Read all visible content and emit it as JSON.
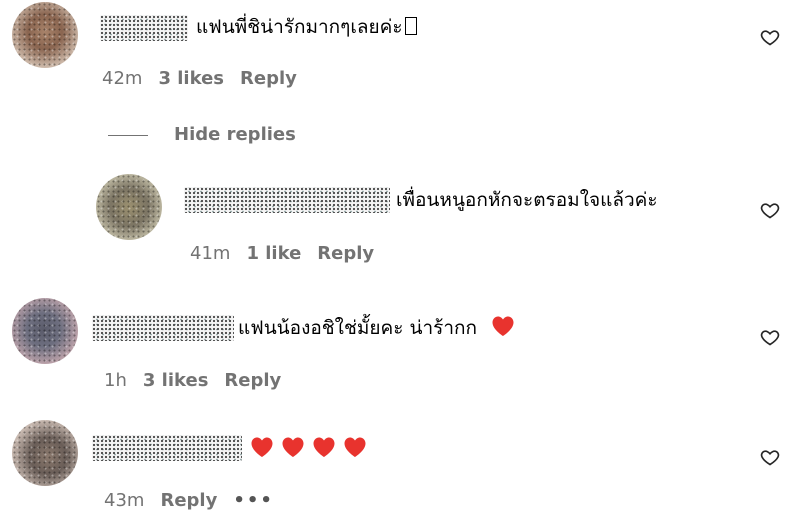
{
  "comments": [
    {
      "text": "แฟนพี่ชิน่ารักมากๆเลยค่ะ",
      "trailing_glyph": "",
      "time": "42m",
      "likes": "3 likes",
      "reply": "Reply"
    },
    {
      "text": "เพื่อนหนูอกหักจะตรอมใจแล้วค่ะ",
      "time": "41m",
      "likes": "1 like",
      "reply": "Reply"
    },
    {
      "text": "แฟนน้องอชิใช่มั้ยคะ น่าร้ากก",
      "time": "1h",
      "likes": "3 likes",
      "reply": "Reply"
    },
    {
      "hearts": 4,
      "time": "43m",
      "reply": "Reply",
      "more": "•••"
    }
  ],
  "hide_replies_label": "Hide replies",
  "icons": {
    "like": "heart-outline-icon",
    "emoji": "red-heart-emoji"
  },
  "colors": {
    "meta_text": "#737373",
    "heart_red": "#e8332e"
  }
}
